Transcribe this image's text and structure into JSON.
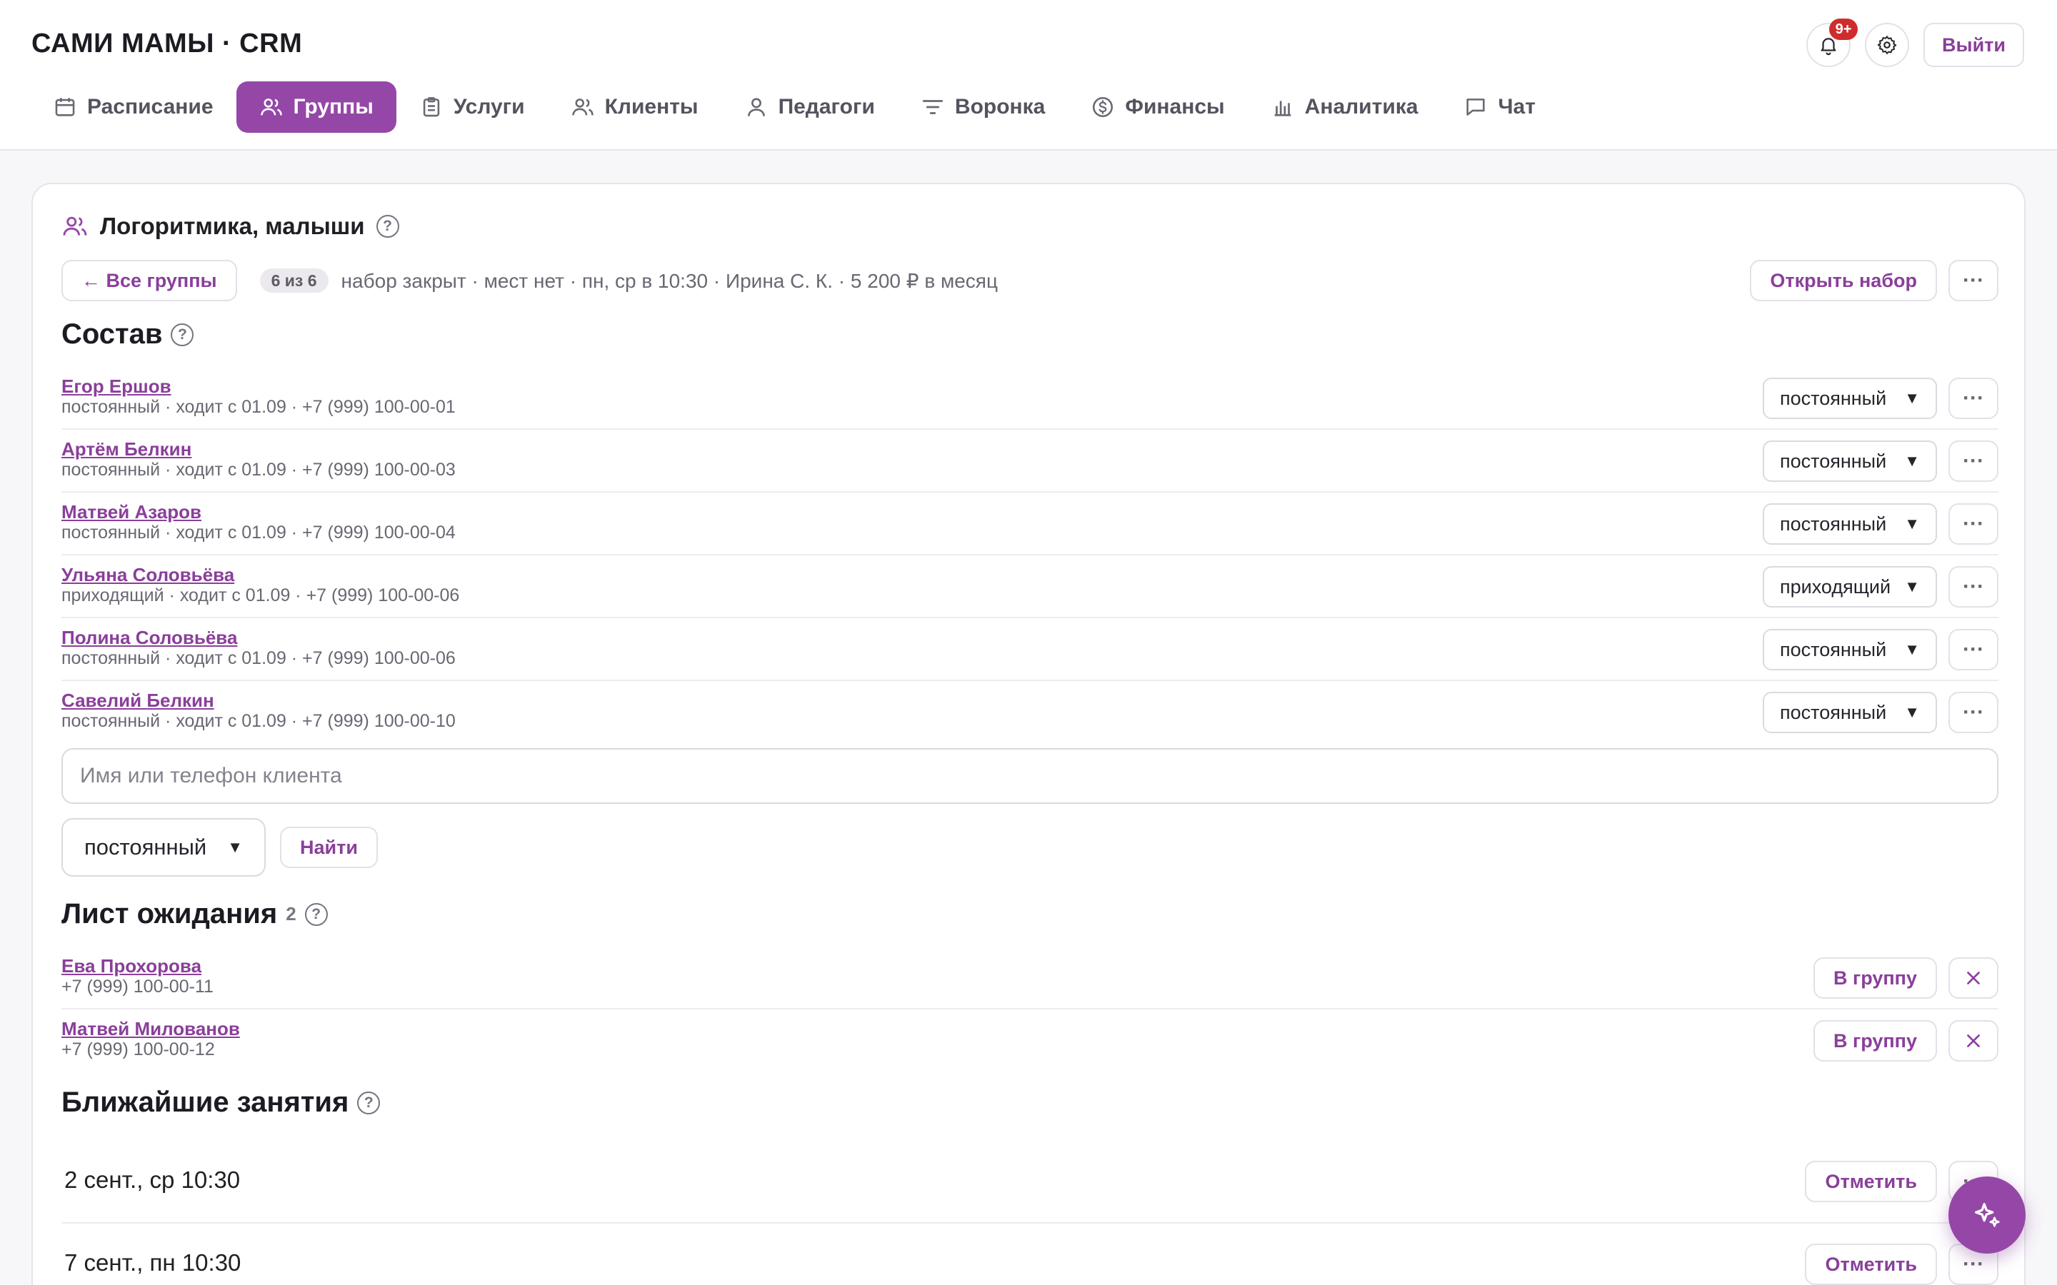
{
  "app": {
    "brand": "САМИ МАМЫ · CRM"
  },
  "header": {
    "notifications_badge": "9+",
    "logout_label": "Выйти"
  },
  "nav": {
    "items": [
      {
        "label": "Расписание",
        "icon": "calendar-icon"
      },
      {
        "label": "Группы",
        "icon": "users-icon",
        "active": true
      },
      {
        "label": "Услуги",
        "icon": "clipboard-icon"
      },
      {
        "label": "Клиенты",
        "icon": "users-icon"
      },
      {
        "label": "Педагоги",
        "icon": "user-icon"
      },
      {
        "label": "Воронка",
        "icon": "filter-icon"
      },
      {
        "label": "Финансы",
        "icon": "dollar-icon"
      },
      {
        "label": "Аналитика",
        "icon": "bar-chart-icon"
      },
      {
        "label": "Чат",
        "icon": "chat-icon"
      }
    ]
  },
  "group": {
    "title": "Логоритмика, малыши",
    "help": "?",
    "back_label": "← Все группы",
    "count_badge": "6 из 6",
    "meta": "набор закрыт · мест нет · пн, ср в 10:30 · Ирина С. К. · 5 200 ₽ в месяц",
    "open_enrollment_label": "Открыть набор",
    "more": "···"
  },
  "members": {
    "title": "Состав",
    "help": "?",
    "rows": [
      {
        "name": "Егор Ершов",
        "sub": "постоянный · ходит с 01.09 · +7 (999) 100-00-01",
        "status": "постоянный"
      },
      {
        "name": "Артём Белкин",
        "sub": "постоянный · ходит с 01.09 · +7 (999) 100-00-03",
        "status": "постоянный"
      },
      {
        "name": "Матвей Азаров",
        "sub": "постоянный · ходит с 01.09 · +7 (999) 100-00-04",
        "status": "постоянный"
      },
      {
        "name": "Ульяна Соловьёва",
        "sub": "приходящий · ходит с 01.09 · +7 (999) 100-00-06",
        "status": "приходящий"
      },
      {
        "name": "Полина Соловьёва",
        "sub": "постоянный · ходит с 01.09 · +7 (999) 100-00-06",
        "status": "постоянный"
      },
      {
        "name": "Савелий Белкин",
        "sub": "постоянный · ходит с 01.09 · +7 (999) 100-00-10",
        "status": "постоянный"
      }
    ],
    "search_placeholder": "Имя или телефон клиента",
    "add_status": "постоянный",
    "find_label": "Найти"
  },
  "waitlist": {
    "title": "Лист ожидания",
    "count": "2",
    "help": "?",
    "rows": [
      {
        "name": "Ева Прохорова",
        "phone": "+7 (999) 100-00-11",
        "action": "В группу"
      },
      {
        "name": "Матвей Милованов",
        "phone": "+7 (999) 100-00-12",
        "action": "В группу"
      }
    ]
  },
  "lessons": {
    "title": "Ближайшие занятия",
    "help": "?",
    "rows": [
      {
        "date": "2 сент., ср 10:30",
        "action": "Отметить"
      },
      {
        "date": "7 сент., пн 10:30",
        "action": "Отметить"
      }
    ]
  },
  "colors": {
    "accent": "#9547a8",
    "accent_text": "#8a3f9a",
    "badge": "#d12c2c"
  }
}
